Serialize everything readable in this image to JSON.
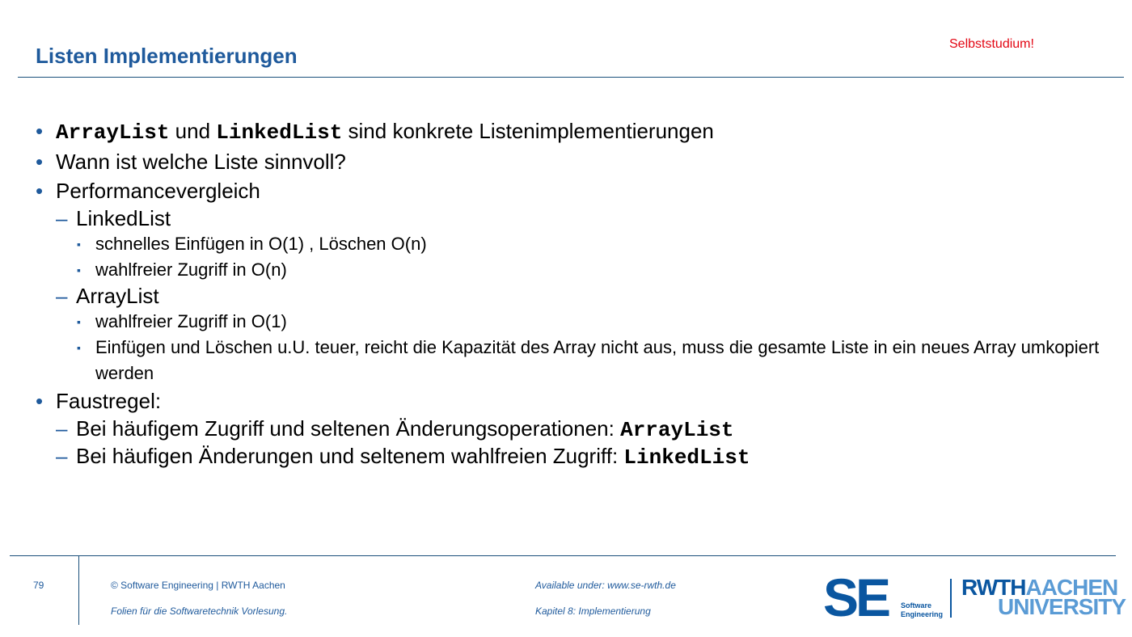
{
  "header": {
    "title": "Listen Implementierungen",
    "tag": "Selbststudium!"
  },
  "bullets": {
    "b1": {
      "code1": "ArrayList",
      "mid": " und ",
      "code2": "LinkedList",
      "rest": " sind konkrete Listenimplementierungen"
    },
    "b2": "Wann ist welche Liste sinnvoll?",
    "b3": "Performancevergleich",
    "linked": {
      "label": "LinkedList",
      "items": [
        "schnelles Einfügen in O(1) , Löschen O(n)",
        "wahlfreier Zugriff in O(n)"
      ]
    },
    "array": {
      "label": "ArrayList",
      "items": [
        "wahlfreier Zugriff in O(1)",
        "Einfügen und Löschen u.U. teuer, reicht die Kapazität des Array nicht aus, muss die gesamte Liste in ein neues Array umkopiert werden"
      ]
    },
    "b4": "Faustregel:",
    "rule1": {
      "text": "Bei häufigem Zugriff und seltenen Änderungsoperationen: ",
      "code": "ArrayList"
    },
    "rule2": {
      "text": "Bei häufigen Änderungen und seltenem wahlfreien Zugriff: ",
      "code": "LinkedList"
    }
  },
  "markers": {
    "level1": "•",
    "level2": "–",
    "level3": "▪"
  },
  "footer": {
    "page": "79",
    "copyright": "©  Software Engineering  |  RWTH Aachen",
    "course": "Folien für die Softwaretechnik Vorlesung.",
    "available": "Available under:  www.se-rwth.de",
    "chapter": "Kapitel 8: Implementierung"
  },
  "logos": {
    "se_s": "S",
    "se_e": "E",
    "se_sub1": "Software",
    "se_sub2": "Engineering",
    "rwth_a": "RWTH",
    "rwth_b": "AACHEN",
    "rwth_c": "UNIVERSITY"
  },
  "colors": {
    "accent": "#1f5a9c",
    "tag": "#e30613",
    "logo_dark": "#0a56a0",
    "logo_light": "#5a9bd5"
  }
}
